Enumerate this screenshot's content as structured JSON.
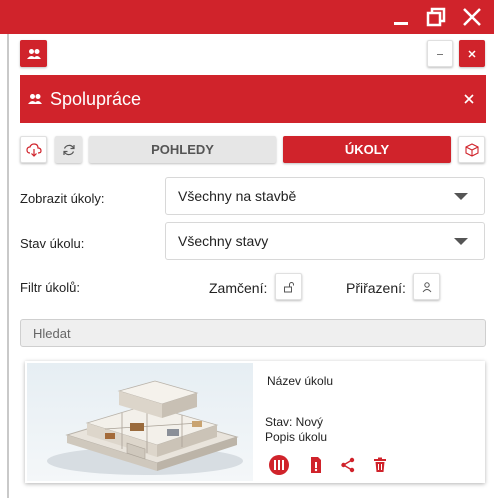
{
  "window": {
    "minimize_icon": "minimize-icon",
    "restore_icon": "restore-icon",
    "close_icon": "close-icon"
  },
  "panel": {
    "title": "Spolupráce",
    "users_icon": "users-icon"
  },
  "toolbar": {
    "pohledy_label": "POHLEDY",
    "ukoly_label": "ÚKOLY"
  },
  "filters": {
    "show_label": "Zobrazit úkoly:",
    "show_value": "Všechny na stavbě",
    "status_label": "Stav úkolu:",
    "status_value": "Všechny stavy",
    "filter_label": "Filtr úkolů:",
    "lock_label": "Zamčení:",
    "assign_label": "Přiřazení:"
  },
  "search": {
    "placeholder": "Hledat"
  },
  "task": {
    "name": "Název úkolu",
    "status": "Stav: Nový",
    "description": "Popis úkolu"
  },
  "colors": {
    "accent": "#d0232b"
  }
}
